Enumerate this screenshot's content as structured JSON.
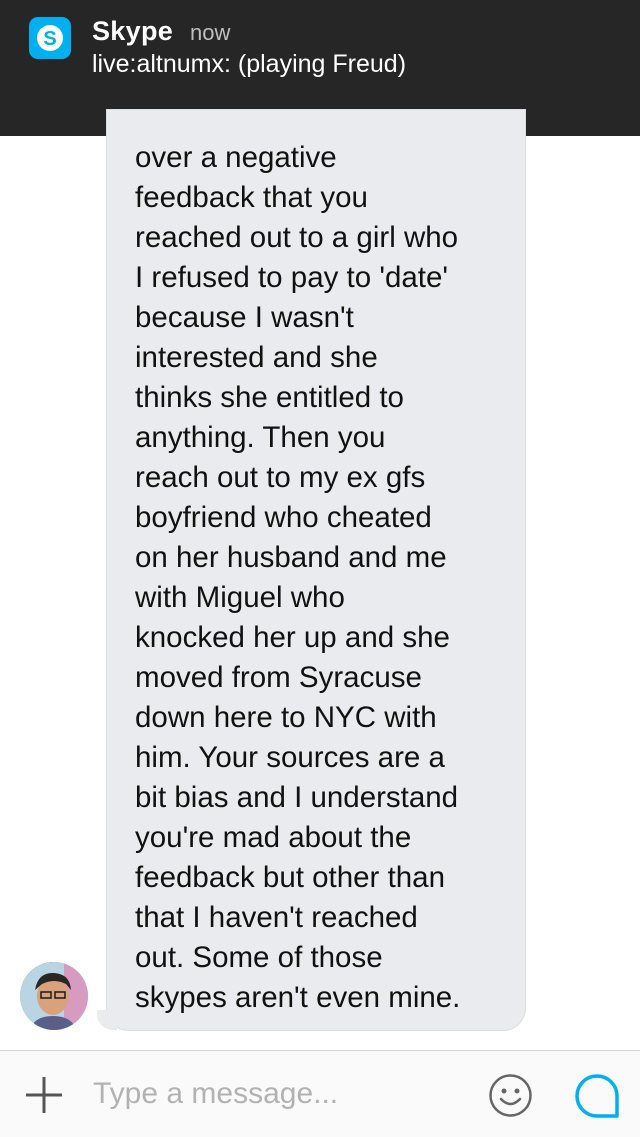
{
  "notification": {
    "app_name": "Skype",
    "time": "now",
    "message": "live:altnumx: (playing Freud)",
    "icon": "skype-icon"
  },
  "message": {
    "text": "over a negative\nfeedback that you\nreached out to a girl who\nI refused to pay to 'date'\nbecause I wasn't\ninterested and she\nthinks she entitled to\nanything. Then you\nreach out to my ex gfs\nboyfriend who cheated\non her husband and me\nwith Miguel who\nknocked her up and she\nmoved from Syracuse\ndown here to NYC with\nhim. Your sources are a\nbit bias and I understand\nyou're mad about the\nfeedback but other than\nthat I haven't reached\nout. Some of those\nskypes aren't even mine."
  },
  "compose": {
    "placeholder": "Type a message...",
    "add_icon": "plus-icon",
    "emoji_icon": "emoji-icon",
    "send_icon": "skype-icon"
  },
  "colors": {
    "accent": "#00aff0",
    "bubble": "#e9ebef",
    "banner": "#262626"
  }
}
